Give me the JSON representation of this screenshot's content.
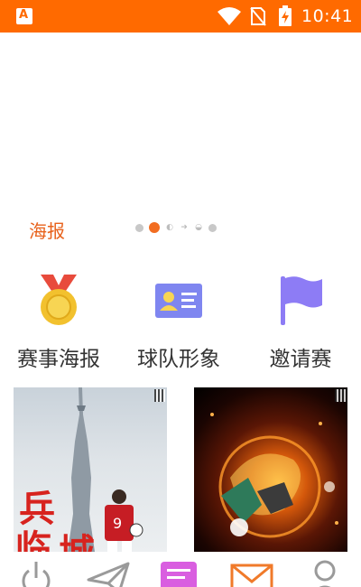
{
  "status_bar": {
    "time": "10:41",
    "app_icon": "app-a-icon",
    "icons": [
      "wifi-icon",
      "no-sim-icon",
      "battery-charging-icon"
    ]
  },
  "banner": {
    "pager_dots": 6,
    "active_dot": 1
  },
  "section": {
    "title": "海报"
  },
  "categories": [
    {
      "label": "赛事海报",
      "icon": "medal-icon",
      "color": "#f2c12e"
    },
    {
      "label": "球队形象",
      "icon": "id-card-icon",
      "color": "#7f86f0"
    },
    {
      "label": "邀请赛",
      "icon": "flag-icon",
      "color": "#8d7cf5"
    }
  ],
  "posters": [
    {
      "name": "poster-canton-tower-footballer",
      "text": "兵 临 城",
      "jersey_number": "9"
    },
    {
      "name": "poster-fire-football"
    }
  ],
  "bottom_nav": {
    "items": [
      {
        "icon": "power-icon"
      },
      {
        "icon": "send-icon"
      },
      {
        "icon": "notes-icon",
        "color": "#d95ee0"
      },
      {
        "icon": "mail-icon",
        "color": "#f07a2a"
      },
      {
        "icon": "profile-icon"
      }
    ]
  },
  "colors": {
    "accent": "#ff6a00",
    "section_title": "#e8621c"
  }
}
